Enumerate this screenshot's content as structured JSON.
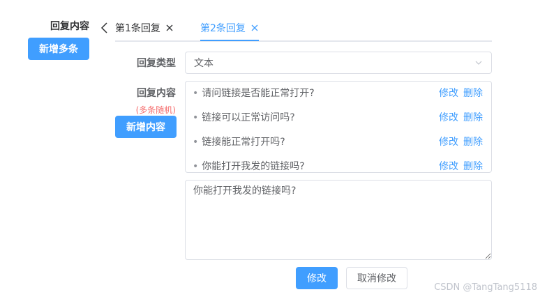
{
  "left": {
    "section_label": "回复内容",
    "add_multi_button": "新增多条"
  },
  "tabs": [
    {
      "label": "第1条回复",
      "active": false
    },
    {
      "label": "第2条回复",
      "active": true
    }
  ],
  "form": {
    "type_label": "回复类型",
    "type_value": "文本",
    "content_label": "回复内容",
    "random_note": "(多条随机)",
    "add_content_button": "新增内容",
    "items": [
      {
        "text": "请问链接是否能正常打开?",
        "edit": "修改",
        "delete": "删除"
      },
      {
        "text": "链接可以正常访问吗?",
        "edit": "修改",
        "delete": "删除"
      },
      {
        "text": "链接能正常打开吗?",
        "edit": "修改",
        "delete": "删除"
      },
      {
        "text": "你能打开我发的链接吗?",
        "edit": "修改",
        "delete": "删除"
      }
    ],
    "textarea_value": "你能打开我发的链接吗?",
    "save_button": "修改",
    "cancel_button": "取消修改"
  },
  "watermark": "CSDN @TangTang5118",
  "colors": {
    "primary": "#409eff",
    "danger": "#f56c6c",
    "border": "#dcdfe6",
    "text": "#606266"
  },
  "icons": {
    "tab_prev": "chevron-left-icon",
    "tab_close": "close-icon",
    "select_arrow": "chevron-down-icon"
  }
}
